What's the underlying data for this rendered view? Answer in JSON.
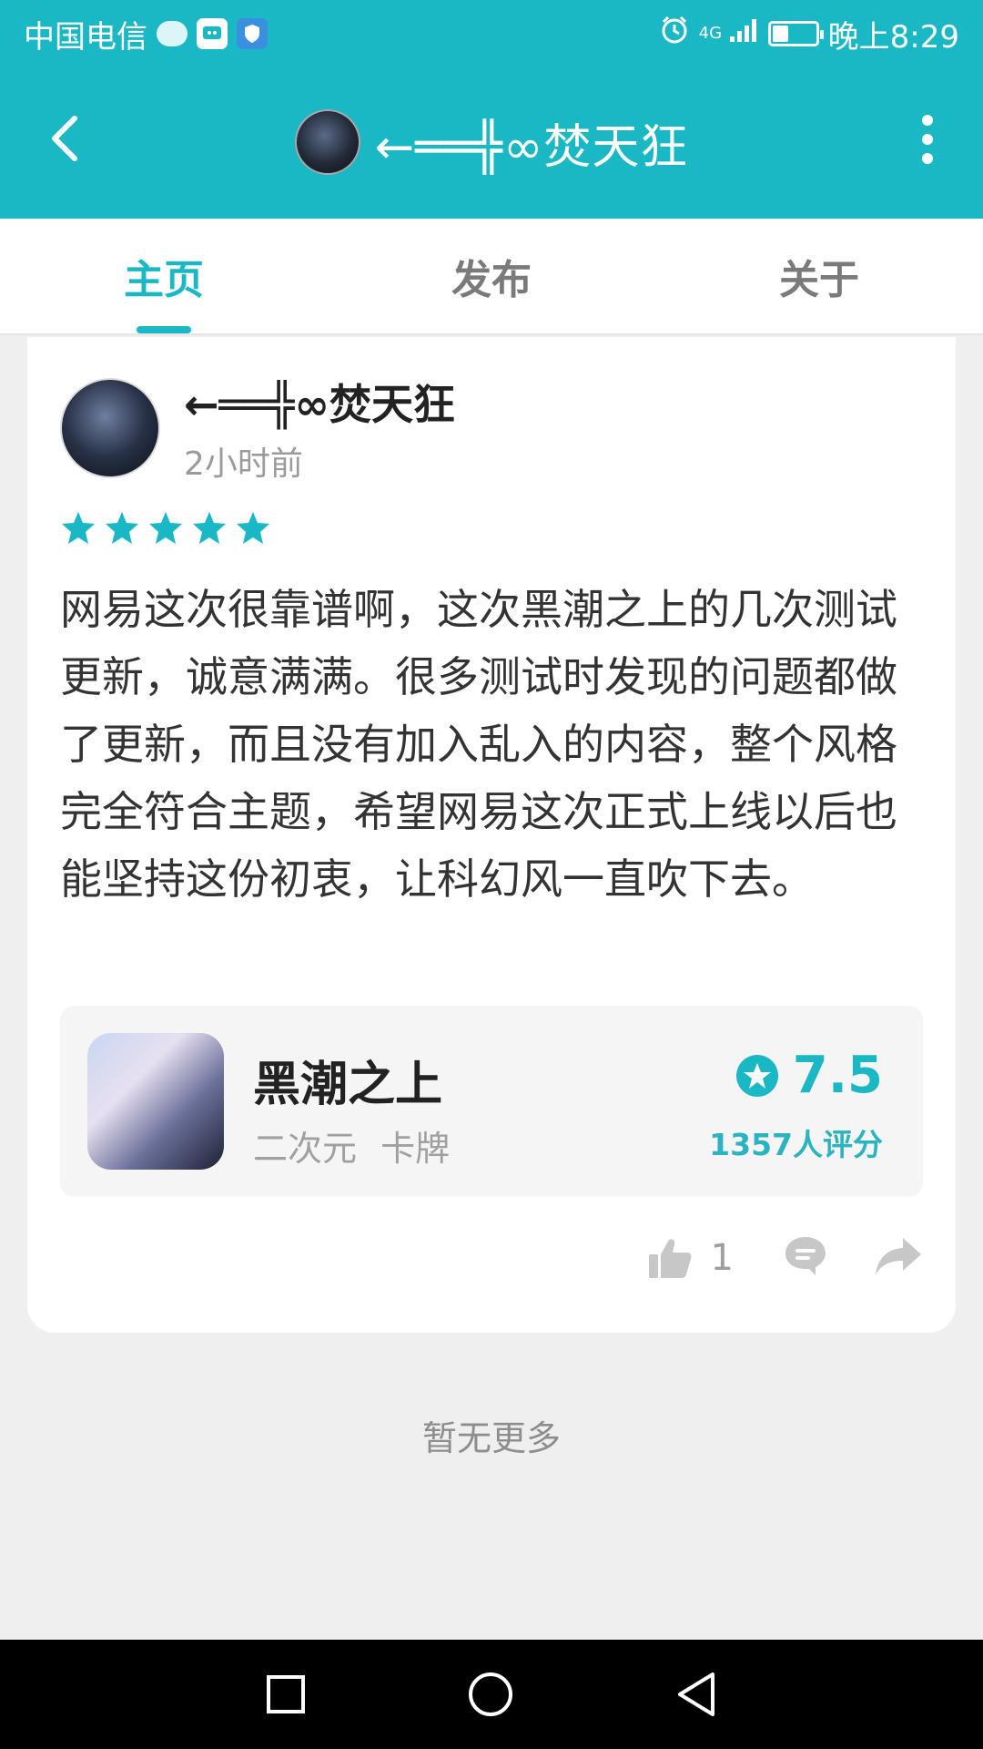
{
  "status_bar": {
    "carrier": "中国电信",
    "network": "4G",
    "time": "晚上8:29",
    "battery_level": 0.35,
    "icons": [
      "message-bubble-icon",
      "app-notification-icon",
      "shield-icon",
      "alarm-icon",
      "signal-icon",
      "battery-icon"
    ]
  },
  "header": {
    "title": "←══╬∞焚天狂",
    "back_icon": "back-arrow-icon",
    "more_icon": "more-vertical-icon"
  },
  "tabs": [
    {
      "label": "主页",
      "active": true
    },
    {
      "label": "发布",
      "active": false
    },
    {
      "label": "关于",
      "active": false
    }
  ],
  "review": {
    "author": "←══╬∞焚天狂",
    "time_ago": "2小时前",
    "rating_stars": 5,
    "text": "网易这次很靠谱啊，这次黑潮之上的几次测试更新，诚意满满。很多测试时发现的问题都做 了更新，而且没有加入乱入的内容，整个风格完全符合主题，希望网易这次正式上线以后也能坚持这份初衷，让科幻风一直吹下去。",
    "game": {
      "name": "黑潮之上",
      "tags": "二次元  卡牌",
      "score": "7.5",
      "rating_count": "1357人评分"
    },
    "likes": "1"
  },
  "footer": {
    "no_more": "暂无更多"
  },
  "colors": {
    "accent": "#1ab8c4",
    "background": "#efefef",
    "card": "#ffffff"
  }
}
